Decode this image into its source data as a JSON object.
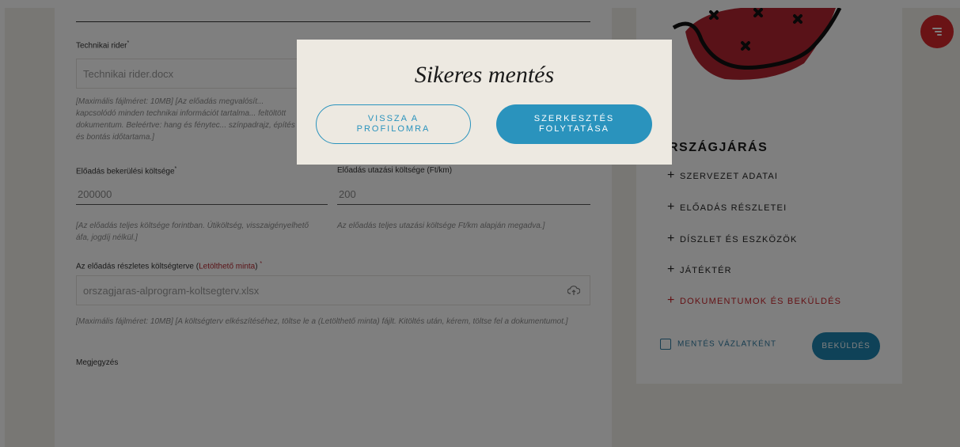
{
  "form": {
    "technical_rider": {
      "label": "Technikai rider",
      "required_mark": "*",
      "value": "Technikai rider.docx",
      "hint": "[Maximális fájlméret: 10MB] [Az előadás megvalósít... kapcsolódó minden technikai információt tartalma... feltöltött dokumentum. Beleértve: hang és fénytec... színpadrajz, építés és bontás időtartama.]"
    },
    "performance_cost": {
      "label": "Előadás bekerülési költsége",
      "required_mark": "*",
      "value": "200000",
      "hint": "[Az előadás teljes költsége forintban. Útiköltség, visszaigényelhető áfa, jogdíj nélkül.]"
    },
    "travel_cost": {
      "label": "Előadás utazási költsége (Ft/km)",
      "value": "200",
      "hint": "Az előadás teljes utazási költsége Ft/km alapján megadva.]"
    },
    "budget": {
      "label_before": "Az előadás részletes költségterve (",
      "link": "Letölthető minta",
      "label_after": ")",
      "required_mark": "*",
      "value": "orszagjaras-alprogram-koltsegterv.xlsx",
      "hint": "[Maximális fájlméret: 10MB] [A költségterv elkészítéséhez, töltse le a (Letölthető minta) fájlt. Kitöltés után, kérem, töltse fel a dokumentumot.]"
    },
    "note": {
      "label": "Megjegyzés"
    }
  },
  "sidebar": {
    "title": "RSZÁGJÁRÁS",
    "items": [
      {
        "label": "SZERVEZET ADATAI",
        "active": false
      },
      {
        "label": "ELŐADÁS RÉSZLETEI",
        "active": false
      },
      {
        "label": "DÍSZLET ÉS ESZKÖZÖK",
        "active": false
      },
      {
        "label": "JÁTÉKTÉR",
        "active": false
      },
      {
        "label": "DOKUMENTUMOK ÉS BEKÜLDÉS",
        "active": true
      }
    ],
    "plus": "+",
    "save_draft": "MENTÉS VÁZLATKÉNT",
    "submit": "BEKÜLDÉS"
  },
  "modal": {
    "title": "Sikeres mentés",
    "back_button": "VISSZA A PROFILOMRA",
    "continue_button": "SZERKESZTÉS FOLYTATÁSA"
  },
  "colors": {
    "accent_blue": "#2a93bd",
    "accent_red": "#c8242b",
    "modal_bg": "#ede9e1"
  },
  "icons": [
    "upload-cloud-icon",
    "menu-icon",
    "download-box-icon",
    "plus-icon"
  ]
}
